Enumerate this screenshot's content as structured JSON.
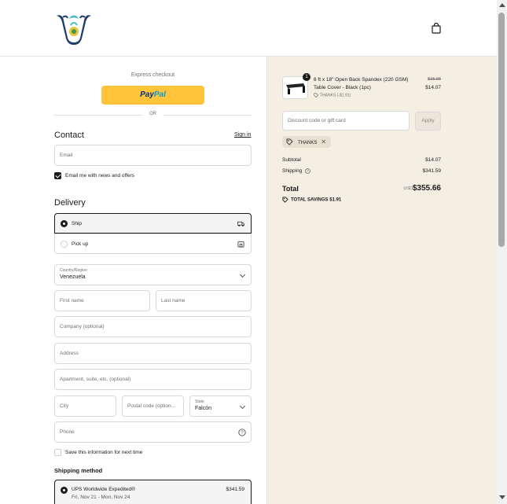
{
  "header": {
    "logo": "store-logo",
    "cart_icon": "shopping-bag-icon"
  },
  "express": {
    "title": "Express checkout",
    "paypal_pay": "Pay",
    "paypal_pal": "Pal",
    "or": "OR"
  },
  "contact": {
    "heading": "Contact",
    "sign_in": "Sign in",
    "email_placeholder": "Email",
    "newsletter_label": "Email me with news and offers",
    "newsletter_checked": true
  },
  "delivery": {
    "heading": "Delivery",
    "options": [
      {
        "label": "Ship",
        "selected": true,
        "icon": "truck-icon"
      },
      {
        "label": "Pick up",
        "selected": false,
        "icon": "store-icon"
      }
    ],
    "country_label": "Country/Region",
    "country_value": "Venezuela",
    "first_name": "First name",
    "last_name": "Last name",
    "company": "Company (optional)",
    "address": "Address",
    "apartment": "Apartment, suite, etc. (optional)",
    "city": "City",
    "postal": "Postal code (option...",
    "state_label": "State",
    "state_value": "Falcón",
    "phone": "Phone",
    "save_info": "Save this information for next time"
  },
  "shipping_method": {
    "heading": "Shipping method",
    "name": "UPS Worldwide Expedited®",
    "dates": "Fri, Nov 21 - Mon, Nov 24",
    "price": "$341.59"
  },
  "order": {
    "quantity": "1",
    "product_title": "6 ft x 18\" Open Back Spandex (220 GSM) Table Cover - Black (1pc)",
    "product_discount": "THANKS (-$1.91)",
    "old_price": "$15.98",
    "new_price": "$14.07",
    "discount_placeholder": "Discount code or gift card",
    "apply": "Apply",
    "applied_code": "THANKS",
    "subtotal_label": "Subtotal",
    "subtotal": "$14.07",
    "shipping_label": "Shipping",
    "shipping": "$341.59",
    "total_label": "Total",
    "currency": "USD",
    "total": "$355.66",
    "savings": "TOTAL SAVINGS  $1.91"
  }
}
